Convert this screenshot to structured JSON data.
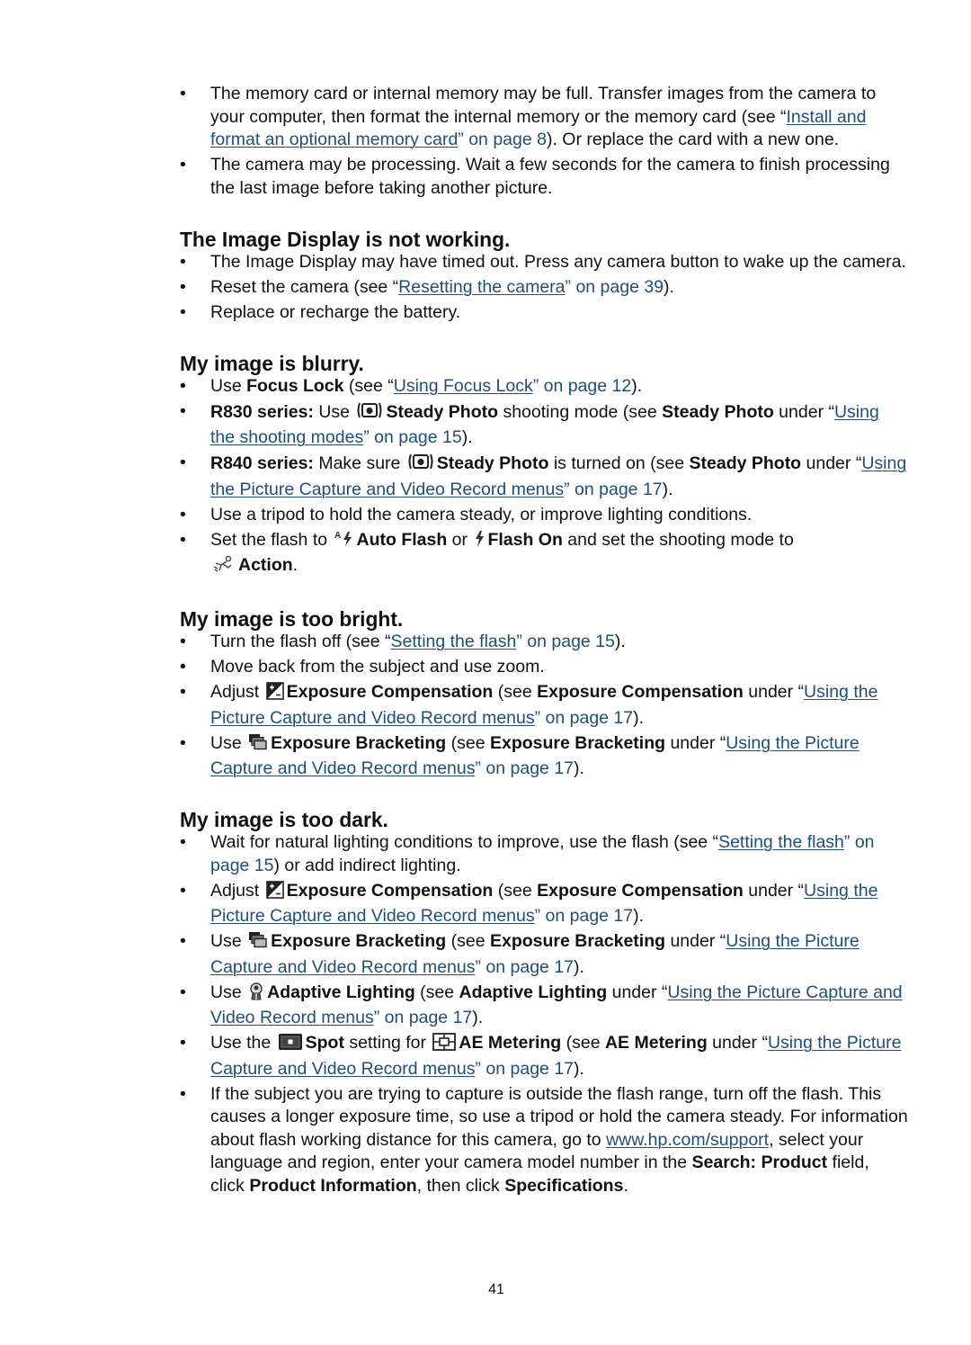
{
  "intro": {
    "items": [
      {
        "pre": "The memory card or internal memory may be full. Transfer images from the camera to your computer, then format the internal memory or the memory card (see “",
        "link": "Install and format an optional memory card",
        "ref": "” on page 8",
        "post": "). Or replace the card with a new one."
      },
      {
        "text": "The camera may be processing. Wait a few seconds for the camera to finish processing the last image before taking another picture."
      }
    ]
  },
  "display_section": {
    "heading": "The Image Display is not working.",
    "items": [
      {
        "text": "The Image Display may have timed out. Press any camera button to wake up the camera."
      },
      {
        "pre": "Reset the camera (see “",
        "link": "Resetting the camera",
        "ref": "” on page 39",
        "post": ")."
      },
      {
        "text": "Replace or recharge the battery."
      }
    ]
  },
  "blurry_section": {
    "heading": "My image is blurry.",
    "items": [
      {
        "pre": "Use ",
        "bold": "Focus Lock",
        "mid": " (see “",
        "link": "Using Focus Lock",
        "ref": "” on page 12",
        "post": ")."
      },
      {
        "bold1": "R830 series:",
        "t1": " Use ",
        "icon": "steady-photo-icon",
        "bold2": "Steady Photo",
        "t2": " shooting mode (see ",
        "bold3": "Steady Photo",
        "t3": " under “",
        "link": "Using the shooting modes",
        "ref": "” on page 15",
        "post": ")."
      },
      {
        "bold1": "R840 series:",
        "t1": " Make sure ",
        "icon": "steady-photo-icon",
        "bold2": "Steady Photo",
        "t2": " is turned on (see ",
        "bold3": "Steady Photo",
        "t3": " under “",
        "link": "Using the Picture Capture and Video Record menus",
        "ref": "” on page 17",
        "post": ")."
      },
      {
        "text": "Use a tripod to hold the camera steady, or improve lighting conditions."
      },
      {
        "t1": "Set the flash to ",
        "icon1": "auto-flash-icon",
        "bold1": "Auto Flash",
        "t2": " or ",
        "icon2": "flash-on-icon",
        "bold2": "Flash On",
        "t3": " and set the shooting mode to ",
        "icon3": "action-mode-icon",
        "bold3": "Action",
        "post": "."
      }
    ]
  },
  "bright_section": {
    "heading": "My image is too bright.",
    "items": [
      {
        "pre": "Turn the flash off (see “",
        "link": "Setting the flash",
        "ref": "” on page 15",
        "post": ")."
      },
      {
        "text": "Move back from the subject and use zoom."
      },
      {
        "t1": "Adjust ",
        "icon": "exposure-compensation-icon",
        "bold1": "Exposure Compensation",
        "t2": " (see ",
        "bold2": "Exposure Compensation",
        "t3": " under “",
        "link": "Using the Picture Capture and Video Record menus",
        "ref": "” on page 17",
        "post": ")."
      },
      {
        "t1": "Use ",
        "icon": "exposure-bracketing-icon",
        "bold1": "Exposure Bracketing",
        "t2": " (see ",
        "bold2": "Exposure Bracketing",
        "t3": " under “",
        "link": "Using the Picture Capture and Video Record menus",
        "ref": "” on page 17",
        "post": ")."
      }
    ]
  },
  "dark_section": {
    "heading": "My image is too dark.",
    "items": [
      {
        "pre": "Wait for natural lighting conditions to improve, use the flash (see “",
        "link": "Setting the flash",
        "ref": "” on page 15",
        "post": ") or add indirect lighting."
      },
      {
        "t1": "Adjust ",
        "icon": "exposure-compensation-icon",
        "bold1": "Exposure Compensation",
        "t2": " (see ",
        "bold2": "Exposure Compensation",
        "t3": " under “",
        "link": "Using the Picture Capture and Video Record menus",
        "ref": "” on page 17",
        "post": ")."
      },
      {
        "t1": "Use ",
        "icon": "exposure-bracketing-icon",
        "bold1": "Exposure Bracketing",
        "t2": " (see ",
        "bold2": "Exposure Bracketing",
        "t3": " under “",
        "link": "Using the Picture Capture and Video Record menus",
        "ref": "” on page 17",
        "post": ")."
      },
      {
        "t1": "Use ",
        "icon": "adaptive-lighting-icon",
        "bold1": "Adaptive Lighting",
        "t2": " (see ",
        "bold2": "Adaptive Lighting",
        "t3": " under “",
        "link": "Using the Picture Capture and Video Record menus",
        "ref": "” on page 17",
        "post": ")."
      },
      {
        "t1": "Use the ",
        "icon1": "spot-metering-icon",
        "bold1": "Spot",
        "t2": " setting for ",
        "icon2": "ae-metering-icon",
        "bold2": "AE Metering",
        "t3": " (see ",
        "bold3": "AE Metering",
        "t4": " under “",
        "link": "Using the Picture Capture and Video Record menus",
        "ref": "” on page 17",
        "post": ")."
      },
      {
        "t1": "If the subject you are trying to capture is outside the flash range, turn off the flash. This causes a longer exposure time, so use a tripod or hold the camera steady. For information about flash working distance for this camera, go to ",
        "link": "www.hp.com/support",
        "t2": ", select your language and region, enter your camera model number in the ",
        "bold1": "Search: Product",
        "t3": " field, click ",
        "bold2": "Product Information",
        "t4": ", then click ",
        "bold3": "Specifications",
        "post": "."
      }
    ]
  },
  "footer": {
    "page_number": "41"
  },
  "colors": {
    "link": "#1f4e79",
    "text": "#111111"
  }
}
